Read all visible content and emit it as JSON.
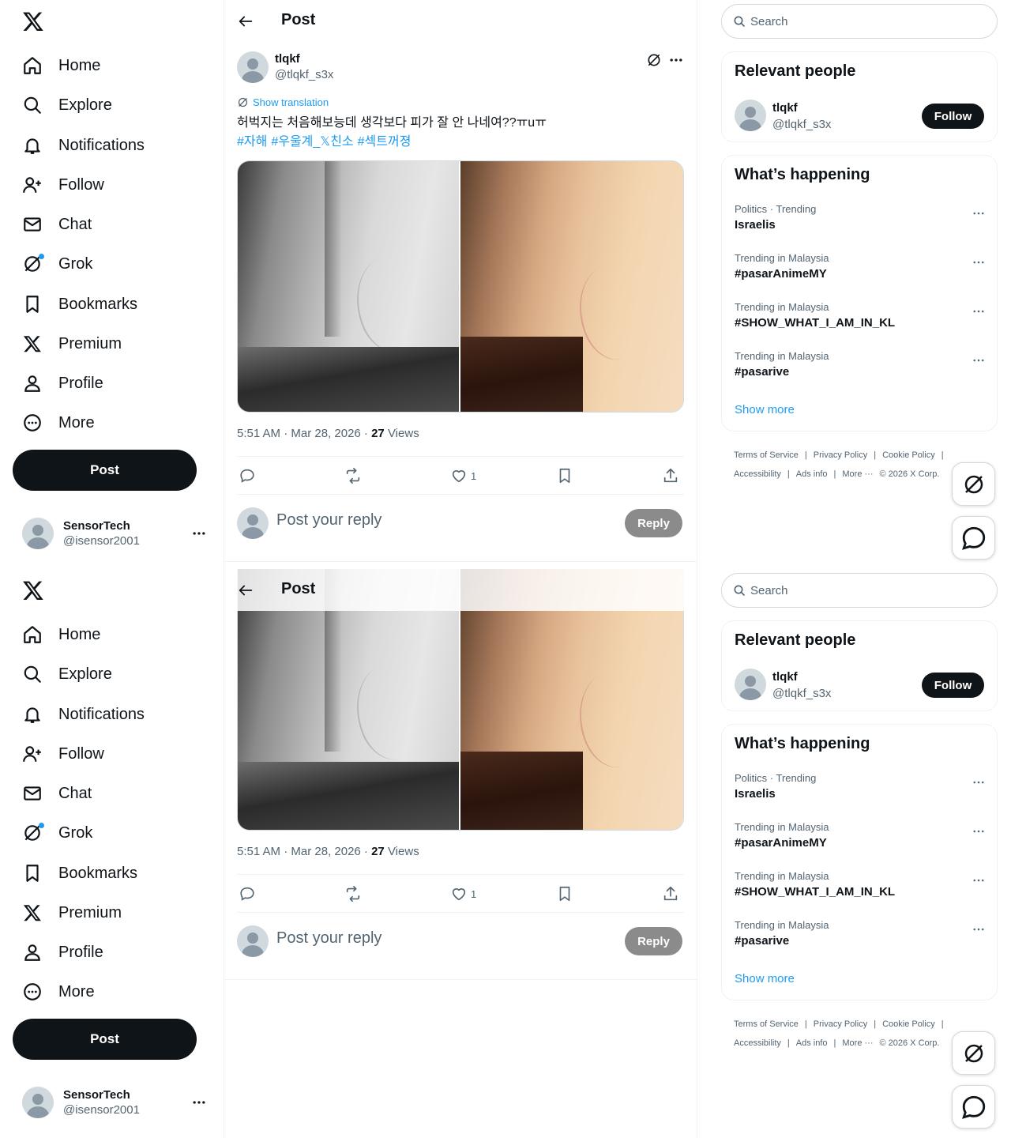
{
  "nav": {
    "logo": "x-logo",
    "items": [
      {
        "label": "Home",
        "icon": "home-icon"
      },
      {
        "label": "Explore",
        "icon": "search-icon"
      },
      {
        "label": "Notifications",
        "icon": "bell-icon"
      },
      {
        "label": "Follow",
        "icon": "person-add-icon"
      },
      {
        "label": "Chat",
        "icon": "envelope-icon"
      },
      {
        "label": "Grok",
        "icon": "grok-icon"
      },
      {
        "label": "Bookmarks",
        "icon": "bookmark-icon"
      },
      {
        "label": "Premium",
        "icon": "x-icon"
      },
      {
        "label": "Profile",
        "icon": "person-icon"
      },
      {
        "label": "More",
        "icon": "more-circle-icon"
      }
    ],
    "post_label": "Post",
    "account": {
      "name": "SensorTech",
      "handle": "@isensor2001"
    }
  },
  "main": {
    "title": "Post",
    "post": {
      "author": "tlqkf",
      "handle": "@tlqkf_s3x",
      "show_translation": "Show translation",
      "text": "허벅지는 처음해보능데 생각보다 피가 잘 안 나네여??ㅠuㅠ",
      "hashtags": [
        "#자해",
        "#우울계_𝕏친소",
        "#섹트꺼졍"
      ],
      "timestamp": "5:51 AM · Mar 28, 2026 · ",
      "views_count": "27",
      "views_label": " Views",
      "likes": "1"
    },
    "reply": {
      "placeholder": "Post your reply",
      "button": "Reply"
    }
  },
  "right": {
    "search_placeholder": "Search",
    "relevant_title": "Relevant people",
    "person": {
      "name": "tlqkf",
      "handle": "@tlqkf_s3x",
      "follow": "Follow"
    },
    "happening_title": "What’s happening",
    "trends": [
      {
        "context": "Politics · Trending",
        "name": "Israelis"
      },
      {
        "context": "Trending in Malaysia",
        "name": "#pasarAnimeMY"
      },
      {
        "context": "Trending in Malaysia",
        "name": "#SHOW_WHAT_I_AM_IN_KL"
      },
      {
        "context": "Trending in Malaysia",
        "name": "#pasarive"
      }
    ],
    "show_more": "Show more",
    "footer": [
      "Terms of Service",
      "Privacy Policy",
      "Cookie Policy",
      "Accessibility",
      "Ads info",
      "More ···",
      "© 2026 X Corp."
    ]
  },
  "colors": {
    "accent": "#1d9bf0",
    "text": "#0f1419",
    "secondary": "#536471",
    "border": "#eff3f4"
  }
}
